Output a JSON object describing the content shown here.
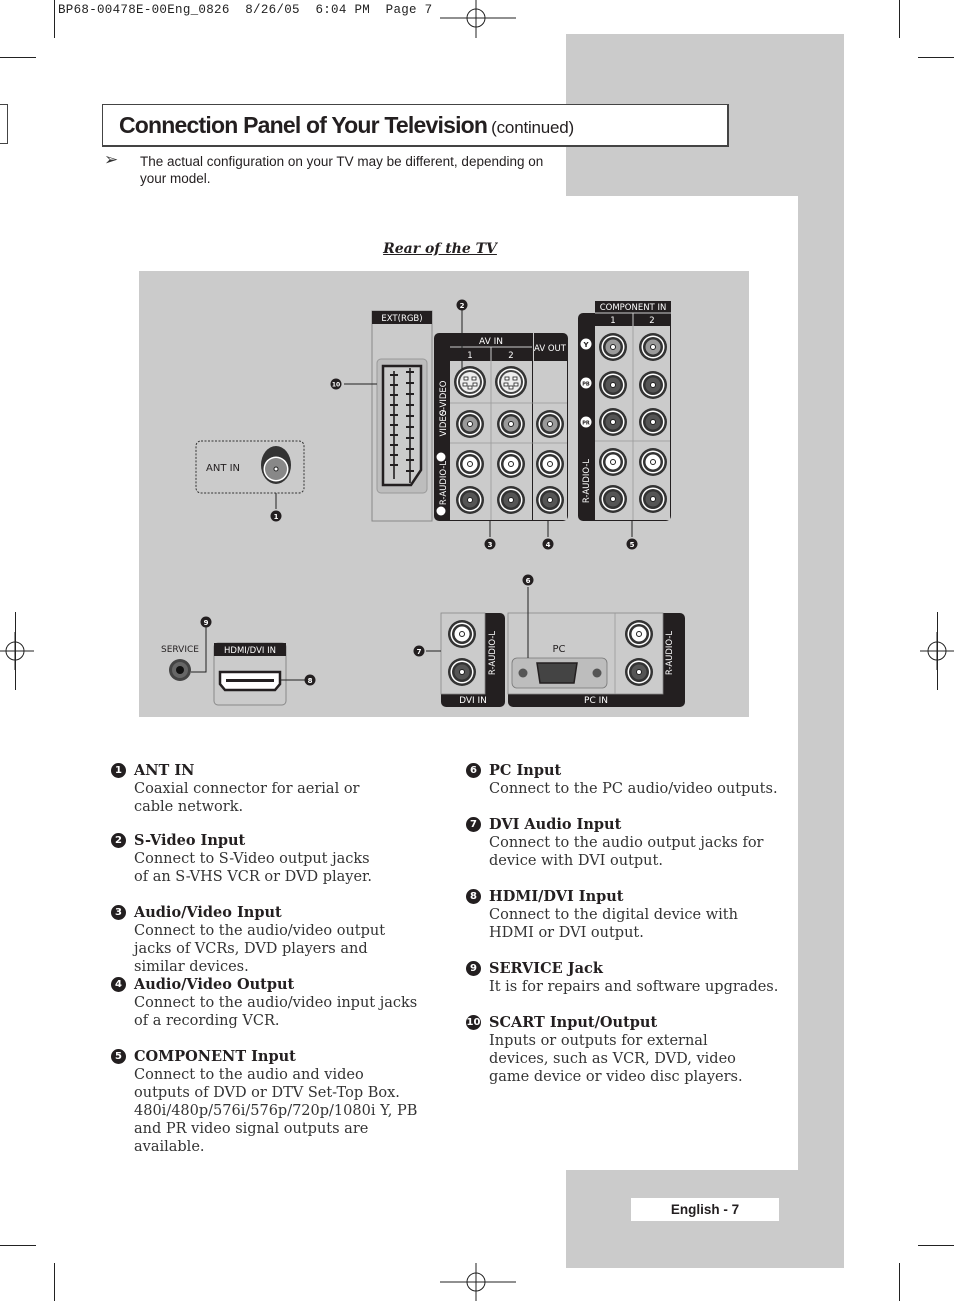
{
  "print_slug": "BP68-00478E-00Eng_0826  8/26/05  6:04 PM  Page 7",
  "header": {
    "title": "Connection Panel of Your Television",
    "title_suffix": "(continued)"
  },
  "note": {
    "icon": "arrow-bullet-icon",
    "arrow_glyph": "➢",
    "text": "The actual configuration on your TV may be different, depending on your model."
  },
  "diagram": {
    "caption": "Rear of the TV",
    "labels": {
      "ant_in": "ANT IN",
      "ext_rgb": "EXT(RGB)",
      "av_in": "AV IN",
      "av_out": "AV OUT",
      "av_in_1": "1",
      "av_in_2": "2",
      "s_video": "S-VIDEO",
      "video": "VIDEO",
      "audio": "R-AUDIO-L",
      "component_in": "COMPONENT IN",
      "component_1": "1",
      "component_2": "2",
      "y": "Y",
      "pb": "PB",
      "pr": "PR",
      "service": "SERVICE",
      "hdmi_dvi_in": "HDMI/DVI IN",
      "dvi_in": "DVI IN",
      "pc": "PC",
      "pc_in": "PC IN"
    },
    "callouts": [
      "1",
      "2",
      "3",
      "4",
      "5",
      "6",
      "7",
      "8",
      "9",
      "10"
    ]
  },
  "items_left": [
    {
      "num": "1",
      "title": "ANT IN",
      "desc": "Coaxial connector for aerial or cable network."
    },
    {
      "num": "2",
      "title": "S-Video Input",
      "desc": "Connect to S-Video output jacks of an S-VHS VCR or DVD player."
    },
    {
      "num": "3",
      "title": "Audio/Video Input",
      "desc": "Connect to the audio/video output jacks of VCRs, DVD players and similar devices."
    },
    {
      "num": "4",
      "title": "Audio/Video Output",
      "desc": "Connect to the audio/video input jacks of a recording VCR."
    },
    {
      "num": "5",
      "title": "COMPONENT Input",
      "desc": "Connect to the audio and video outputs of DVD or DTV Set-Top Box.",
      "desc2": "480i/480p/576i/576p/720p/1080i Y, PB and PR video signal outputs are available."
    }
  ],
  "items_right": [
    {
      "num": "6",
      "title": "PC Input",
      "desc": "Connect to the PC audio/video outputs."
    },
    {
      "num": "7",
      "title": "DVI Audio Input",
      "desc": "Connect to the audio output jacks for device with DVI output."
    },
    {
      "num": "8",
      "title": "HDMI/DVI Input",
      "desc": "Connect to the digital device with HDMI or DVI output."
    },
    {
      "num": "9",
      "title": "SERVICE Jack",
      "desc": "It is for repairs and software upgrades."
    },
    {
      "num": "10",
      "title": "SCART Input/Output",
      "desc": "Inputs or outputs for external devices, such as VCR, DVD, video game device or video disc players."
    }
  ],
  "footer": {
    "page_label": "English - 7"
  }
}
